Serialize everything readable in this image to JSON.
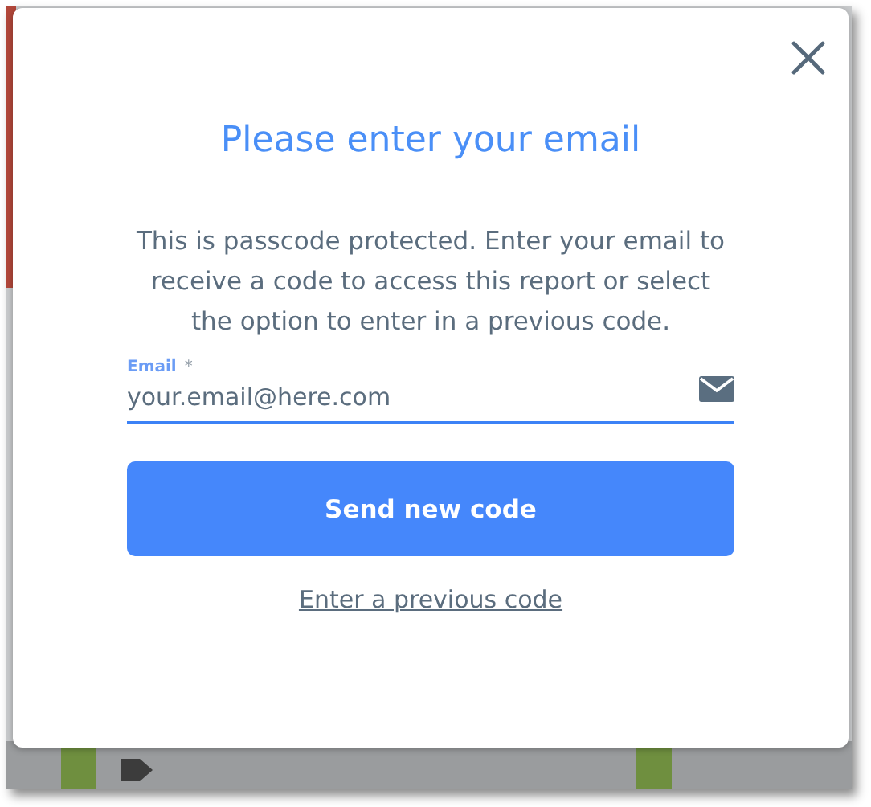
{
  "dialog": {
    "title": "Please enter your email",
    "message": "This is passcode protected. Enter your email to receive a code to access this report or select the option to enter in a previous code.",
    "email_field": {
      "label": "Email",
      "required_mark": "*",
      "placeholder": "your.email@here.com",
      "focused": true
    },
    "primary_button": "Send new code",
    "link": "Enter a previous code"
  }
}
